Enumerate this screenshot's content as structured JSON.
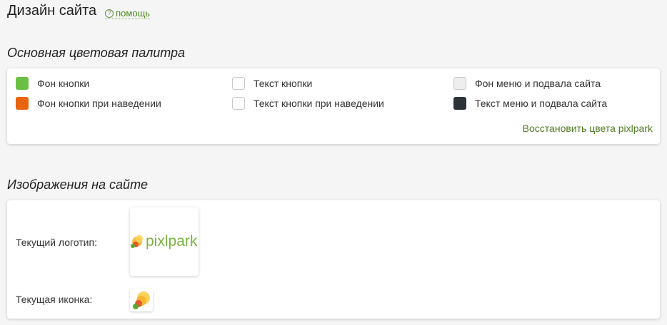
{
  "header": {
    "title": "Дизайн сайта",
    "help_label": "помощь",
    "help_icon": "question-circle-icon"
  },
  "palette": {
    "title": "Основная цветовая палитра",
    "items": [
      {
        "label": "Фон кнопки",
        "color": "#6abf45"
      },
      {
        "label": "Фон кнопки при наведении",
        "color": "#e8640f"
      },
      {
        "label": "Текст кнопки",
        "color": "#ffffff"
      },
      {
        "label": "Текст кнопки при наведении",
        "color": "#ffffff"
      },
      {
        "label": "Фон меню и подвала сайта",
        "color": "#eeeeee"
      },
      {
        "label": "Текст меню и подвала сайта",
        "color": "#2d3138"
      }
    ],
    "restore_label": "Восстановить цвета pixlpark"
  },
  "images": {
    "title": "Изображения на сайте",
    "current_logo_label": "Текущий логотип:",
    "current_icon_label": "Текущая иконка:",
    "logo_text": "pixlpark",
    "logo_color": "#7ab340"
  }
}
